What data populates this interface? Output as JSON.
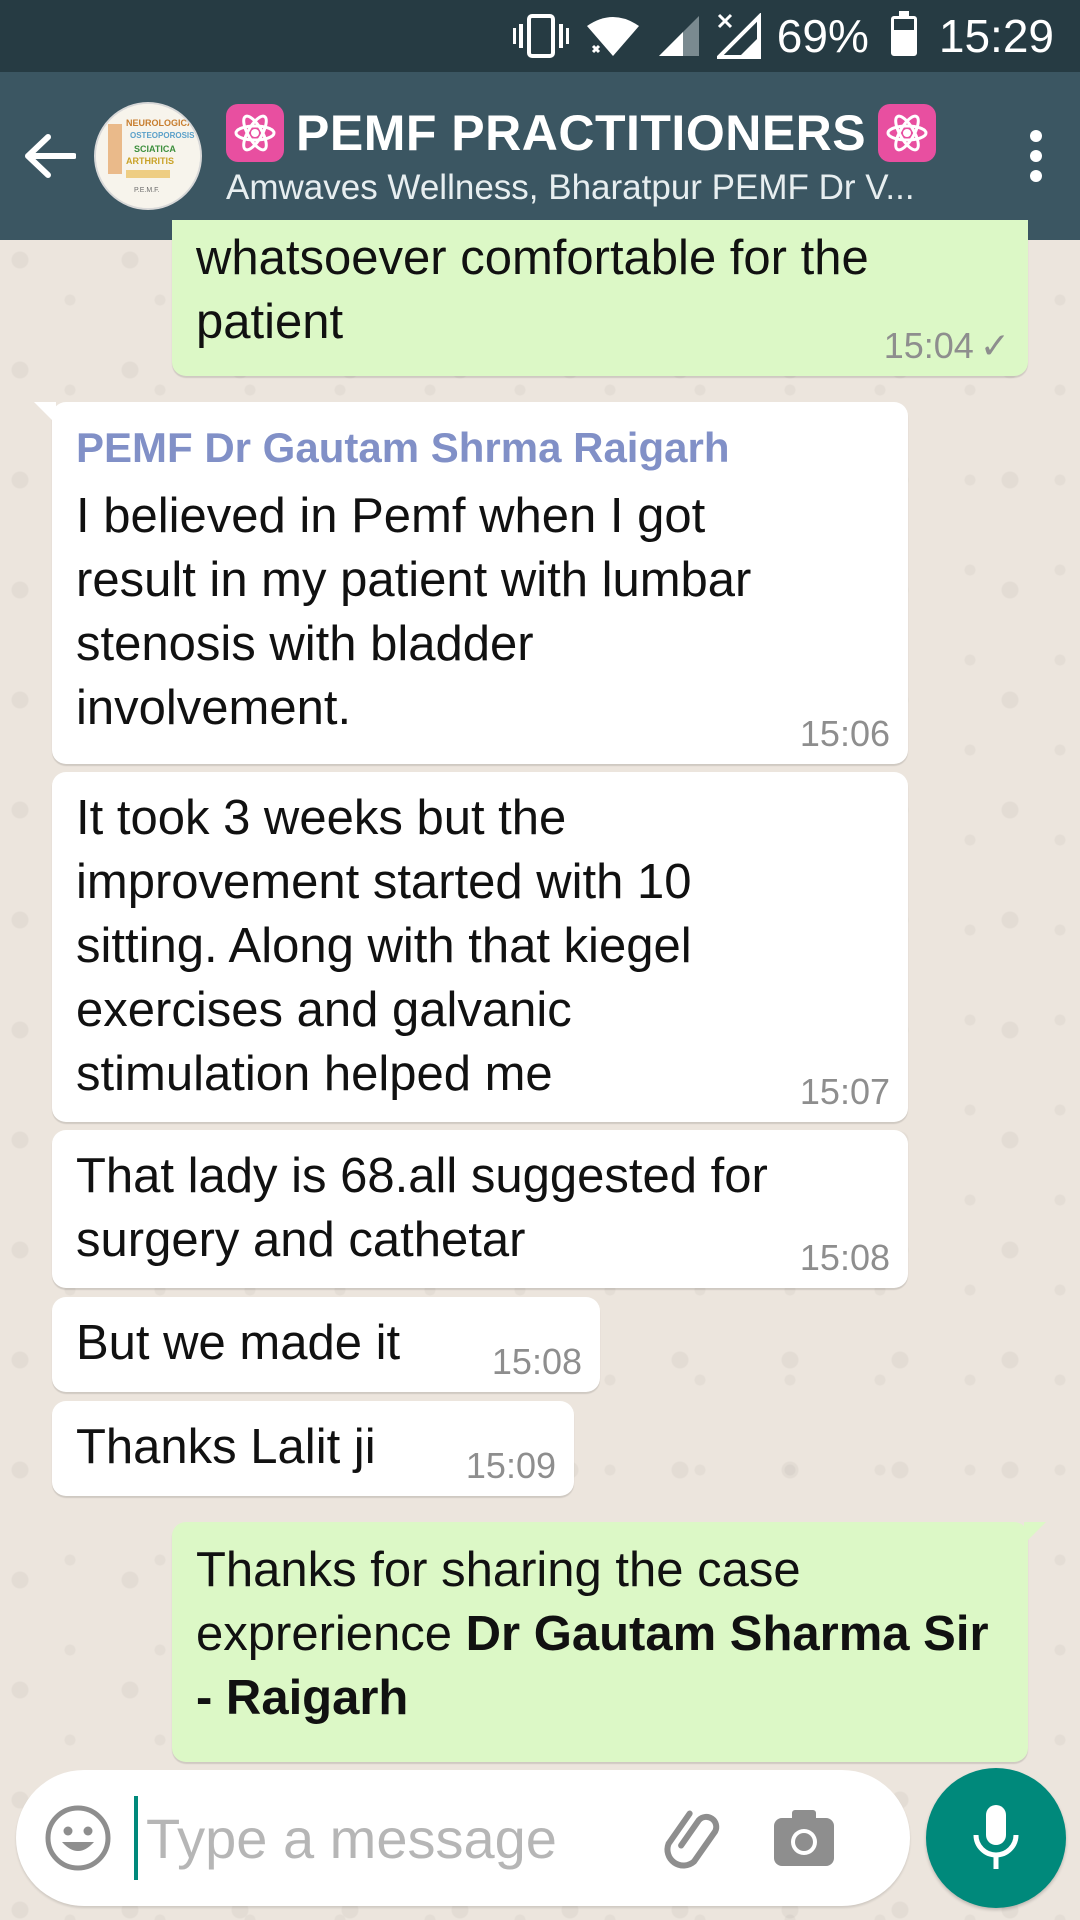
{
  "status_bar": {
    "battery_percent": "69%",
    "battery_level": 0.69,
    "time": "15:29",
    "icons": [
      "vibrate-icon",
      "wifi-icon",
      "signal-icon",
      "no-signal-icon",
      "battery-icon"
    ]
  },
  "header": {
    "title": "PEMF PRACTITIONERS",
    "subtitle": "Amwaves Wellness, Bharatpur PEMF Dr V...",
    "title_emoji": "atom-symbol-icon",
    "avatar_lines": [
      "NEUROLOGICAL",
      "OSTEOPOROSIS",
      "SCIATICA",
      "ARTHRITIS",
      "P.E.M.F."
    ]
  },
  "messages": [
    {
      "direction": "out",
      "text": "whatsoever comfortable for the patient",
      "time": "15:04",
      "status": "sent"
    },
    {
      "direction": "in",
      "sender": "PEMF Dr Gautam Shrma Raigarh",
      "text": "I believed in Pemf when I got result in my patient with lumbar stenosis with bladder involvement.",
      "time": "15:06"
    },
    {
      "direction": "in",
      "text": "It took 3 weeks but the improvement started with 10 sitting. Along with that kiegel exercises and galvanic stimulation helped me",
      "time": "15:07"
    },
    {
      "direction": "in",
      "text": "That lady is 68.all suggested for surgery and cathetar",
      "time": "15:08"
    },
    {
      "direction": "in",
      "text": "But we made it",
      "time": "15:08"
    },
    {
      "direction": "in",
      "text": "Thanks Lalit ji",
      "time": "15:09"
    },
    {
      "direction": "out",
      "text_plain": "Thanks for sharing the case exprerience ",
      "text_bold": "Dr Gautam Sharma Sir - Raigarh"
    }
  ],
  "composer": {
    "placeholder": "Type a message",
    "value": ""
  },
  "colors": {
    "status_bar": "#263b43",
    "app_bar": "#3b5662",
    "outgoing_bubble": "#dcf8c6",
    "incoming_bubble": "#ffffff",
    "sender_name": "#8190c7",
    "accent": "#00897b",
    "wallpaper": "#ece5dd"
  }
}
